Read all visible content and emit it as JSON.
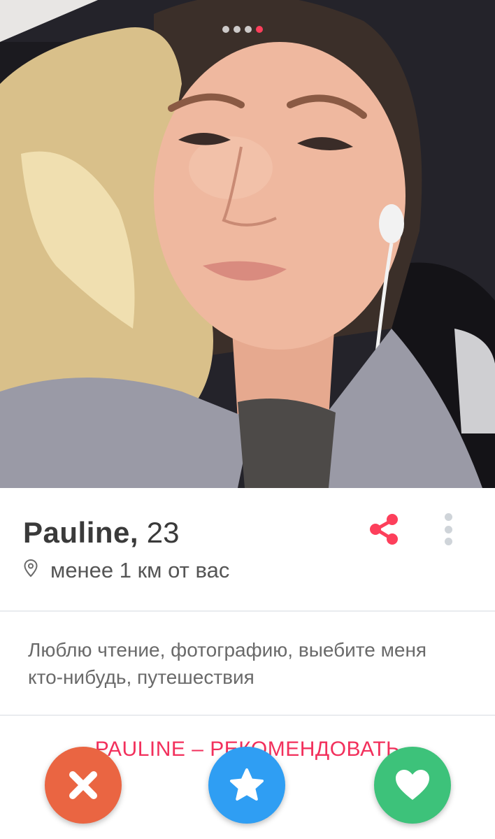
{
  "photo": {
    "dots_total": 4,
    "dots_active_index": 3,
    "accent": "#fd3f5b"
  },
  "profile": {
    "name": "Pauline,",
    "age": "23",
    "distance": "менее 1 км от вас",
    "bio": "Люблю чтение, фотографию, выебите меня кто-нибудь, путешествия",
    "recommend_label": "PAULINE – РЕКОМЕНДОВАТЬ"
  },
  "icons": {
    "share": "share-icon",
    "more": "more-vertical-icon",
    "location": "location-pin-icon",
    "nope": "close-icon",
    "super_like": "star-icon",
    "like": "heart-icon"
  },
  "colors": {
    "brand_red": "#fd3f5b",
    "nope": "#ea6542",
    "super_like": "#2f9ef3",
    "like": "#3dc27a"
  }
}
